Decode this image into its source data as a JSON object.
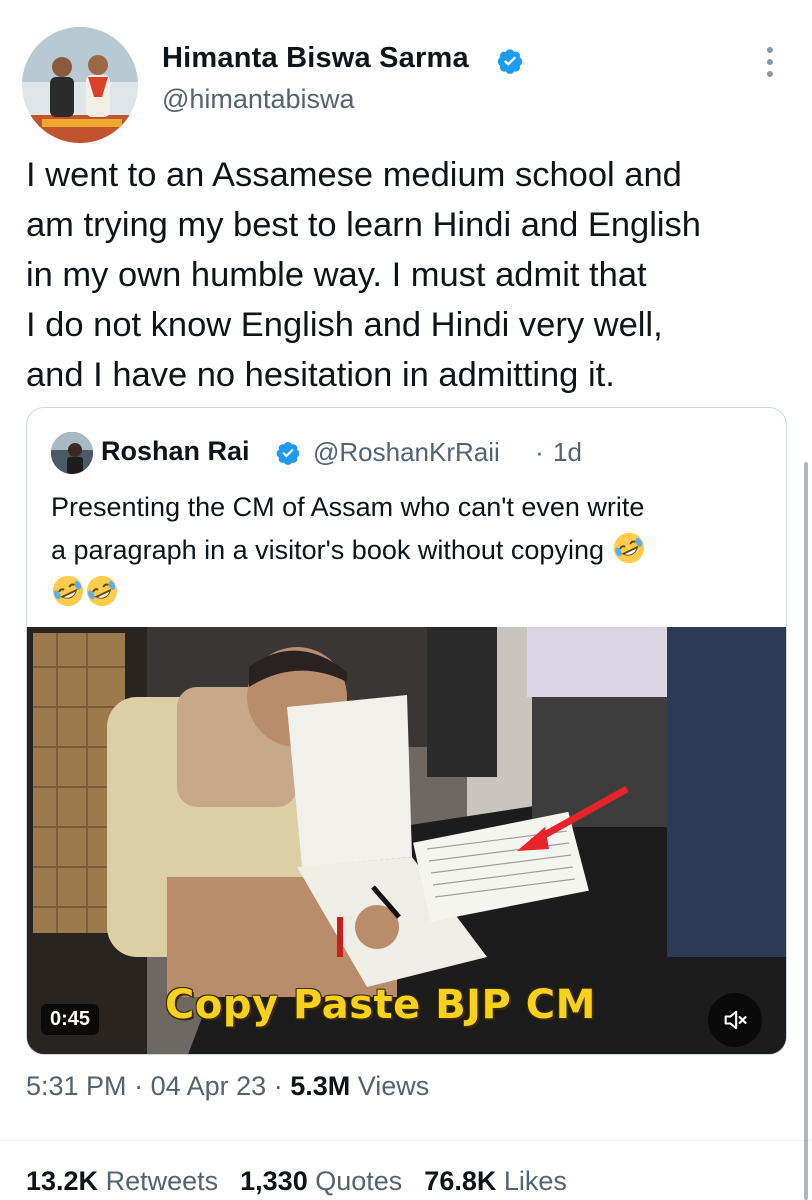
{
  "author": {
    "name": "Himanta Biswa Sarma",
    "handle": "@himantabiswa",
    "verified": true
  },
  "tweet": {
    "lines": [
      "I went to an Assamese medium school and",
      "am trying my best to learn Hindi and English",
      "in my own humble way. I must admit that",
      "I do not know English and Hindi very well,",
      "and I have no hesitation in admitting it."
    ]
  },
  "quoted_tweet": {
    "name": "Roshan Rai",
    "handle": "@RoshanKrRaii",
    "separator": "·",
    "time": "1d",
    "verified": true,
    "text_line1": "Presenting the CM of Assam who can't even write",
    "text_line2": "a paragraph in a visitor's book without copying",
    "emoji_name": "rolling-on-floor-laughing-emoji",
    "video": {
      "caption": "Copy Paste BJP CM",
      "duration": "0:45",
      "mute_icon": "volume-muted-icon"
    }
  },
  "meta": {
    "time": "5:31 PM",
    "dot1": "·",
    "date": "04 Apr 23",
    "dot2": "·",
    "views_count": "5.3M",
    "views_label": "Views"
  },
  "stats": {
    "retweets_count": "13.2K",
    "retweets_label": "Retweets",
    "quotes_count": "1,330",
    "quotes_label": "Quotes",
    "likes_count": "76.8K",
    "likes_label": "Likes"
  },
  "colors": {
    "verified": "#1d9bf0",
    "secondary_text": "#536471",
    "caption": "#f7d21c"
  }
}
